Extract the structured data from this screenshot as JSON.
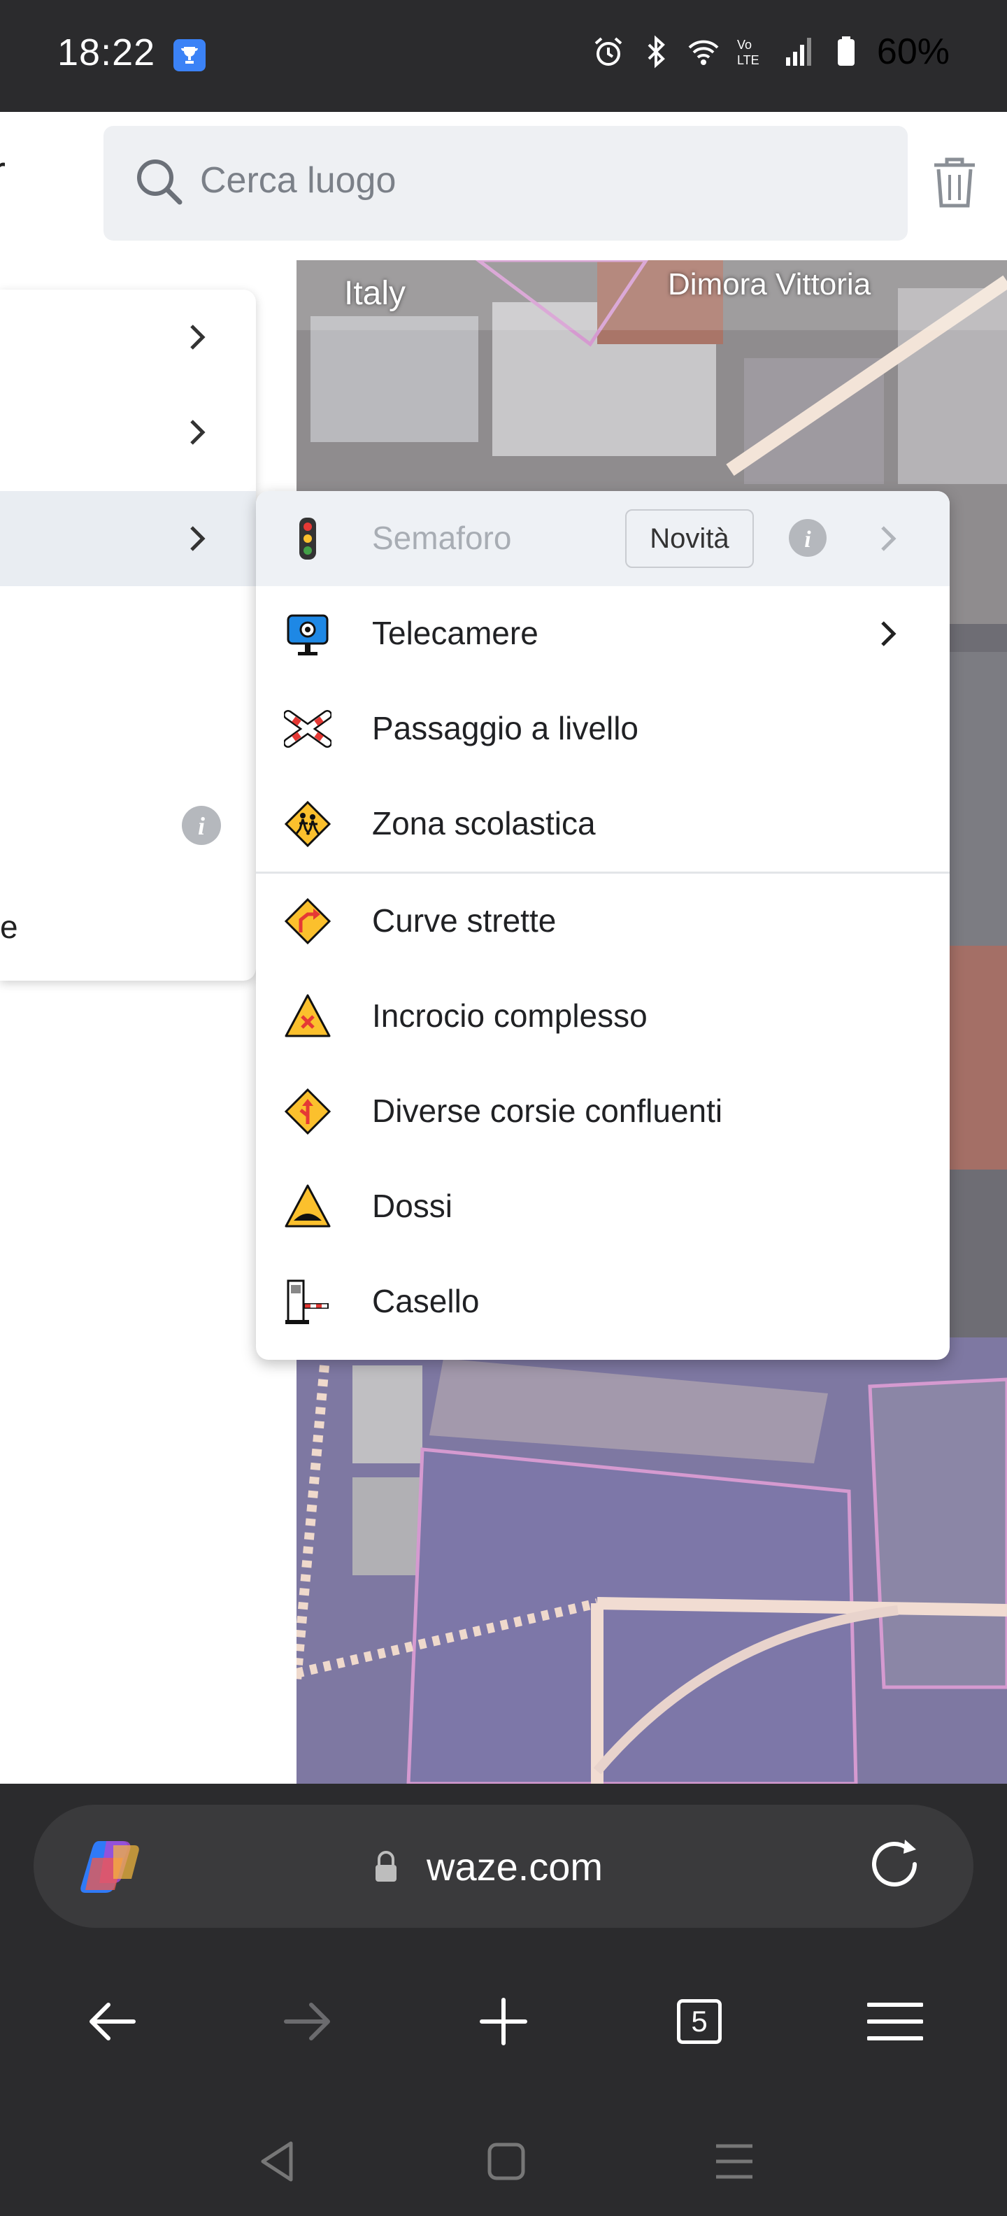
{
  "status_bar": {
    "time": "18:22",
    "battery": "60%",
    "icons": [
      "alarm-icon",
      "bluetooth-icon",
      "wifi-icon",
      "volte-icon",
      "signal-icon",
      "battery-icon"
    ]
  },
  "header": {
    "search_placeholder": "Cerca luogo",
    "back_partial": "r"
  },
  "map": {
    "labels": [
      "Italy",
      "Dimora Vittoria"
    ]
  },
  "left_menu": {
    "partial_text": "e"
  },
  "submenu": {
    "items": [
      {
        "label": "Semaforo",
        "badge": "Novità",
        "disabled": true,
        "icon": "traffic-light-icon"
      },
      {
        "label": "Telecamere",
        "icon": "camera-icon",
        "has_arrow": true
      },
      {
        "label": "Passaggio a livello",
        "icon": "railroad-crossing-icon"
      },
      {
        "label": "Zona scolastica",
        "icon": "school-zone-icon"
      },
      {
        "label": "Curve strette",
        "icon": "sharp-curve-icon"
      },
      {
        "label": "Incrocio complesso",
        "icon": "complex-junction-icon"
      },
      {
        "label": "Diverse corsie confluenti",
        "icon": "merging-lanes-icon"
      },
      {
        "label": "Dossi",
        "icon": "speed-bump-icon"
      },
      {
        "label": "Casello",
        "icon": "toll-booth-icon"
      }
    ]
  },
  "browser": {
    "url": "waze.com",
    "tab_count": "5"
  }
}
